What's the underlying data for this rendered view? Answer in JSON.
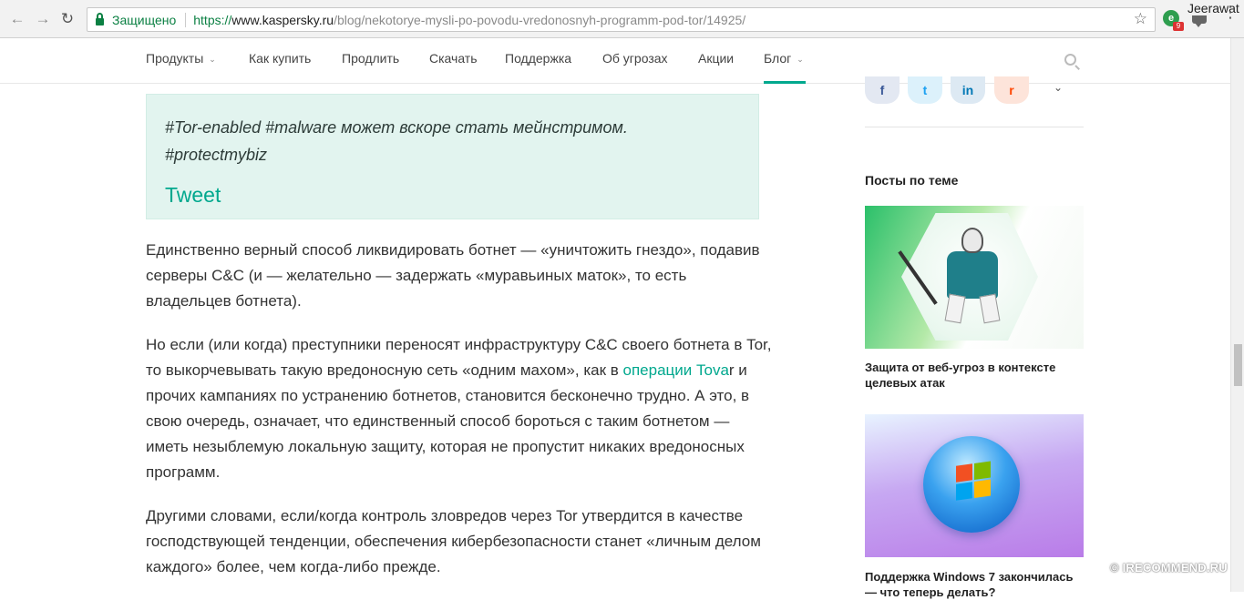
{
  "browser": {
    "secure_label": "Защищено",
    "url_scheme": "https://",
    "url_host": "www.kaspersky.ru",
    "url_path": "/blog/nekotorye-mysli-po-povodu-vredonosnyh-programm-pod-tor/14925/",
    "profile_name": "Jeerawat",
    "extension_badge": "9"
  },
  "nav": {
    "items": [
      {
        "label": "Продукты",
        "has_caret": true
      },
      {
        "label": "Как купить",
        "has_caret": false
      },
      {
        "label": "Продлить",
        "has_caret": false
      },
      {
        "label": "Скачать",
        "has_caret": false
      },
      {
        "label": "Поддержка",
        "has_caret": false
      },
      {
        "label": "Об угрозах",
        "has_caret": false
      },
      {
        "label": "Акции",
        "has_caret": false
      },
      {
        "label": "Блог",
        "has_caret": true,
        "active": true
      }
    ],
    "caret": "⌄",
    "accent_color": "#00a88e"
  },
  "article": {
    "quote_line1": "#Tor-enabled #malware может вскоре стать мейнстримом.",
    "quote_line2": "#protectmybiz",
    "tweet_label": "Tweet",
    "para1": "Единственно верный способ ликвидировать ботнет — «уничтожить гнездо», подавив серверы C&C (и — желательно — задержать «муравьиных маток», то есть владельцев ботнета).",
    "para2_before": "Но если (или когда) преступники переносят инфраструктуру C&C своего ботнета в Tor, то выкорчевывать такую вредоносную сеть «одним махом», как в ",
    "para2_link": "операции Tova",
    "para2_after": "r и прочих кампаниях по устранению ботнетов, становится бесконечно трудно. А это, в свою очередь, означает, что единственный способ бороться с таким ботнетом — иметь незыблемую локальную защиту, которая не пропустит никаких вредоносных программ.",
    "para3": "Другими словами, если/когда контроль зловредов через Tor утвердится в качестве господствующей тенденции, обеспечения кибербезопасности станет «личным делом каждого» более, чем когда-либо прежде."
  },
  "sidebar": {
    "share": {
      "facebook": "f",
      "twitter": "t",
      "linkedin": "in",
      "reddit": "r",
      "more": "⌄"
    },
    "heading": "Посты по теме",
    "posts": [
      {
        "title": "Защита от веб-угроз в контексте целевых атак"
      },
      {
        "title": "Поддержка Windows 7 закончилась — что теперь делать?"
      }
    ]
  },
  "watermark": "© IRECOMMEND.RU"
}
